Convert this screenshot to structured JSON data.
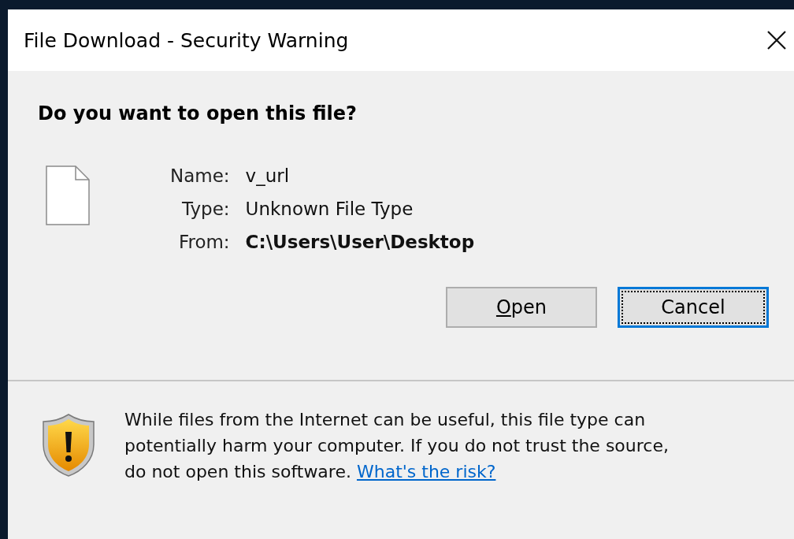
{
  "window": {
    "title": "File Download - Security Warning"
  },
  "heading": "Do you want to open this file?",
  "fields": [
    {
      "label": "Name:",
      "value": "v_url",
      "bold": false
    },
    {
      "label": "Type:",
      "value": "Unknown File Type",
      "bold": false
    },
    {
      "label": "From:",
      "value": "C:\\Users\\User\\Desktop",
      "bold": true
    }
  ],
  "buttons": [
    {
      "label": "Open",
      "access_key_underlined": true,
      "focused": false
    },
    {
      "label": "Cancel",
      "access_key_underlined": false,
      "focused": true
    }
  ],
  "warning": {
    "text": "While files from the Internet can be useful, this file type can potentially harm your computer. If you do not trust the source, do not open this software.",
    "link": "What's the risk?"
  }
}
